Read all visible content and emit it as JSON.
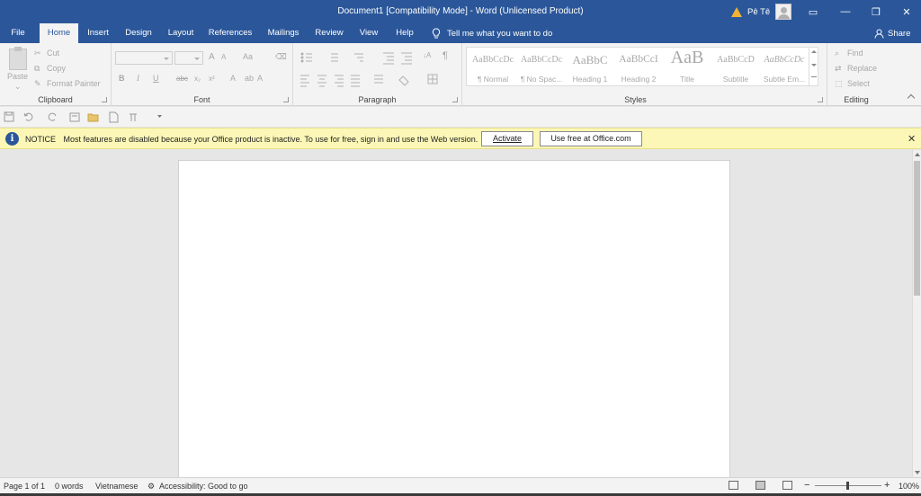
{
  "window": {
    "title": "Document1 [Compatibility Mode] - Word (Unlicensed Product)",
    "user_name": "Pê Tê",
    "controls": {
      "ribbon_display": "▭",
      "minimize": "—",
      "restore": "❐",
      "close": "✕"
    }
  },
  "tabs": [
    {
      "label": "File"
    },
    {
      "label": "Home"
    },
    {
      "label": "Insert"
    },
    {
      "label": "Design"
    },
    {
      "label": "Layout"
    },
    {
      "label": "References"
    },
    {
      "label": "Mailings"
    },
    {
      "label": "Review"
    },
    {
      "label": "View"
    },
    {
      "label": "Help"
    }
  ],
  "active_tab": "Home",
  "tell_me": "Tell me what you want to do",
  "share": "Share",
  "ribbon": {
    "clipboard": {
      "paste": "Paste",
      "cut": "Cut",
      "copy": "Copy",
      "format_painter": "Format Painter",
      "label": "Clipboard"
    },
    "font": {
      "label": "Font",
      "grow": "A",
      "shrink": "A",
      "case": "Aa",
      "clear": "⌫",
      "bold": "B",
      "italic": "I",
      "underline": "U",
      "strike": "abc",
      "subscript": "x₂",
      "superscript": "x²",
      "effects": "A",
      "highlight": "ab",
      "color": "A"
    },
    "paragraph": {
      "label": "Paragraph",
      "sort": "↓A",
      "pilcrow": "¶"
    },
    "styles": {
      "label": "Styles",
      "items": [
        {
          "sample": "AaBbCcDc",
          "name": "¶ Normal"
        },
        {
          "sample": "AaBbCcDc",
          "name": "¶ No Spac..."
        },
        {
          "sample": "AaBbC",
          "name": "Heading 1"
        },
        {
          "sample": "AaBbCcI",
          "name": "Heading 2"
        },
        {
          "sample": "AaB",
          "name": "Title"
        },
        {
          "sample": "AaBbCcD",
          "name": "Subtitle"
        },
        {
          "sample": "AaBbCcDc",
          "name": "Subtle Em..."
        }
      ]
    },
    "editing": {
      "label": "Editing",
      "find": "Find",
      "replace": "Replace",
      "select": "Select"
    }
  },
  "notice": {
    "badge": "NOTICE",
    "message": "Most features are disabled because your Office product is inactive. To use for free, sign in and use the Web version.",
    "activate": "Activate",
    "use_free": "Use free at Office.com",
    "close": "✕"
  },
  "status": {
    "page": "Page 1 of 1",
    "words": "0 words",
    "language": "Vietnamese",
    "accessibility": "Accessibility: Good to go",
    "zoom_out": "−",
    "zoom_in": "+",
    "zoom": "100%"
  },
  "colors": {
    "brand": "#2b579a",
    "notice_bg": "#fcf7b6",
    "warning": "#f2b233"
  }
}
